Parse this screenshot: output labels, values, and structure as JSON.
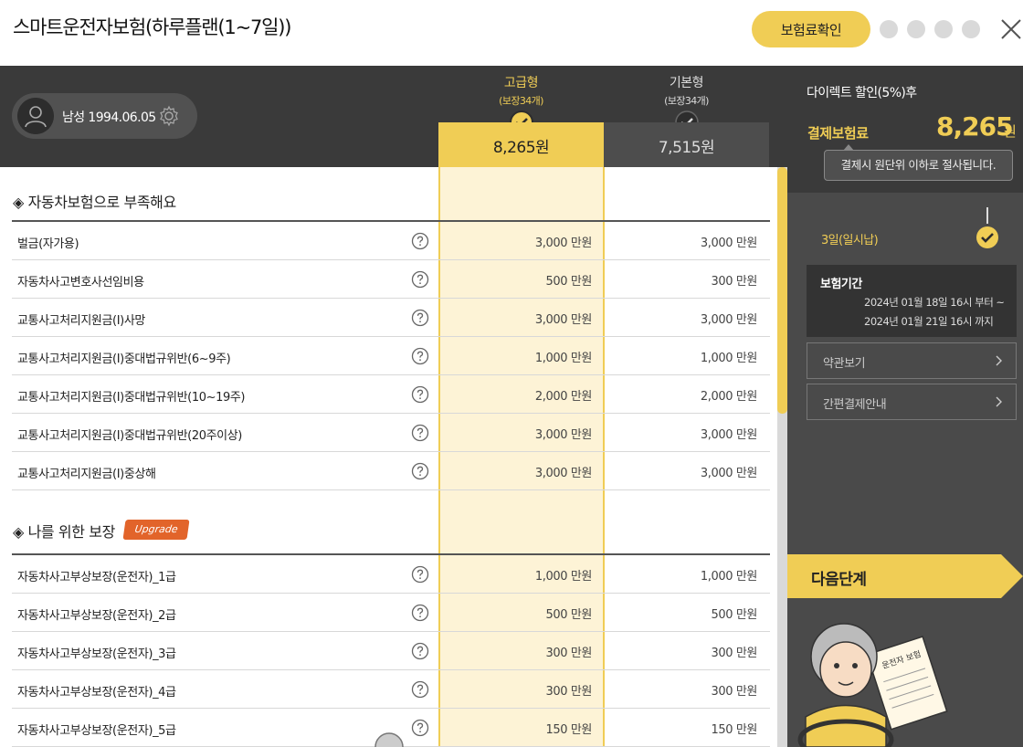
{
  "header": {
    "title": "스마트운전자보험(하루플랜(1~7일))",
    "premium_button": "보험료확인"
  },
  "user": {
    "gender_birth": "남성 1994.06.05"
  },
  "plans": [
    {
      "name": "고급형",
      "coverage": "(보장34개)",
      "price": "8,265원"
    },
    {
      "name": "기본형",
      "coverage": "(보장34개)",
      "price": "7,515원"
    }
  ],
  "sections": [
    {
      "title": "◈ 자동차보험으로 부족해요",
      "rows": [
        {
          "label": "벌금(자가용)",
          "v1": "3,000 만원",
          "v2": "3,000 만원"
        },
        {
          "label": "자동차사고변호사선임비용",
          "v1": "500 만원",
          "v2": "300 만원"
        },
        {
          "label": "교통사고처리지원금(I)사망",
          "v1": "3,000 만원",
          "v2": "3,000 만원"
        },
        {
          "label": "교통사고처리지원금(I)중대법규위반(6~9주)",
          "v1": "1,000 만원",
          "v2": "1,000 만원"
        },
        {
          "label": "교통사고처리지원금(I)중대법규위반(10~19주)",
          "v1": "2,000 만원",
          "v2": "2,000 만원"
        },
        {
          "label": "교통사고처리지원금(I)중대법규위반(20주이상)",
          "v1": "3,000 만원",
          "v2": "3,000 만원"
        },
        {
          "label": "교통사고처리지원금(I)중상해",
          "v1": "3,000 만원",
          "v2": "3,000 만원"
        }
      ]
    },
    {
      "title": "◈ 나를 위한 보장",
      "badge": "Upgrade",
      "rows": [
        {
          "label": "자동차사고부상보장(운전자)_1급",
          "v1": "1,000 만원",
          "v2": "1,000 만원"
        },
        {
          "label": "자동차사고부상보장(운전자)_2급",
          "v1": "500 만원",
          "v2": "500 만원"
        },
        {
          "label": "자동차사고부상보장(운전자)_3급",
          "v1": "300 만원",
          "v2": "300 만원"
        },
        {
          "label": "자동차사고부상보장(운전자)_4급",
          "v1": "300 만원",
          "v2": "300 만원"
        },
        {
          "label": "자동차사고부상보장(운전자)_5급",
          "v1": "150 만원",
          "v2": "150 만원"
        }
      ]
    }
  ],
  "sidebar": {
    "discount_label": "다이렉트 할인(5%)후",
    "pay_label": "결제보험료",
    "pay_value": "8,265",
    "pay_unit": "원",
    "tooltip": "결제시 원단위 이하로 절사됩니다.",
    "day_label": "3일(일시납)",
    "period_label": "보험기간",
    "period_from": "2024년 01월 18일 16시 부터 ~",
    "period_to": "2024년 01월 21일 16시 까지",
    "terms_button": "약관보기",
    "easy_pay_button": "간편결제안내",
    "next_button": "다음단계",
    "illustration_sign": "운전자 보험"
  },
  "colors": {
    "accent": "#f0cd55",
    "dark": "#3a3a3a",
    "sidebar": "#4a4a4a",
    "upgrade": "#e2642a",
    "highlight_col": "#fdf3d6"
  },
  "icons": {
    "close": "close-icon",
    "user": "user-icon",
    "settings": "gear-icon",
    "check": "check-circle-icon",
    "help": "question-circle-icon",
    "chevron": "chevron-right-icon"
  }
}
